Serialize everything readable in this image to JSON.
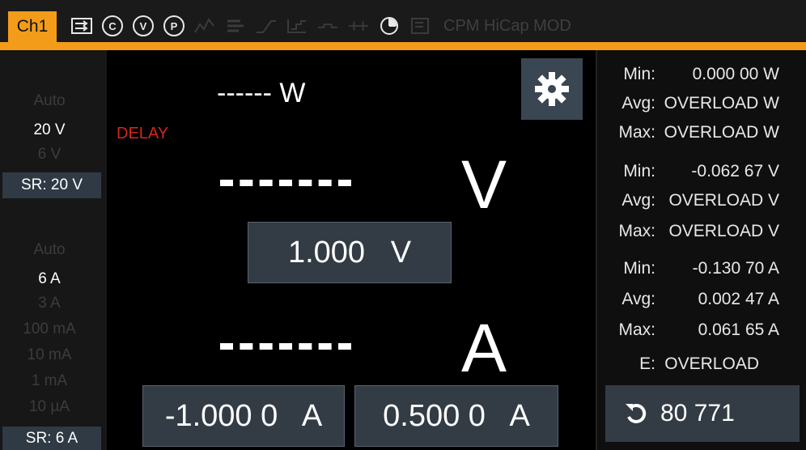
{
  "colors": {
    "accent": "#f39c19",
    "delay": "#d2271f",
    "field": "#333c45"
  },
  "topbar": {
    "channel_tab": "Ch1",
    "icons": [
      "measurement-icon",
      "c-circle-icon",
      "v-circle-icon",
      "p-circle-icon",
      "trend-icon",
      "bars-icon",
      "step-icon",
      "sweep-icon",
      "pulse-icon",
      "ramp-icon",
      "timer-icon",
      "frame-icon"
    ],
    "icon_glyphs": {
      "c": "C",
      "v": "V",
      "p": "P"
    },
    "device_label": "CPM HiCap MOD"
  },
  "voltage_range": {
    "options": [
      "Auto",
      "20 V",
      "6 V"
    ],
    "selected": "20 V",
    "sr_label": "SR: 20 V"
  },
  "current_range": {
    "options": [
      "Auto",
      "6 A",
      "3 A",
      "100 mA",
      "10 mA",
      "1 mA",
      "10 µA"
    ],
    "selected": "6 A",
    "sr_label": "SR: 6 A"
  },
  "main": {
    "power_reading": "------ W",
    "delay_label": "DELAY",
    "voltage_unit": "V",
    "current_unit": "A",
    "voltage_setpoint": "1.000   V",
    "current_neg_limit": "-1.000 0   A",
    "current_pos_limit": "0.500 0   A"
  },
  "stats": {
    "power": [
      {
        "label": "Min:",
        "value": "0.000 00 W"
      },
      {
        "label": "Avg:",
        "value": "OVERLOAD W"
      },
      {
        "label": "Max:",
        "value": "OVERLOAD W"
      }
    ],
    "voltage": [
      {
        "label": "Min:",
        "value": "-0.062 67 V"
      },
      {
        "label": "Avg:",
        "value": "OVERLOAD V"
      },
      {
        "label": "Max:",
        "value": "OVERLOAD V"
      }
    ],
    "current": [
      {
        "label": "Min:",
        "value": "-0.130 70 A"
      },
      {
        "label": "Avg:",
        "value": "0.002 47 A"
      },
      {
        "label": "Max:",
        "value": "0.061 65 A"
      }
    ],
    "energy": {
      "label": "E:",
      "value": "OVERLOAD"
    }
  },
  "counter": {
    "value": "80 771"
  }
}
